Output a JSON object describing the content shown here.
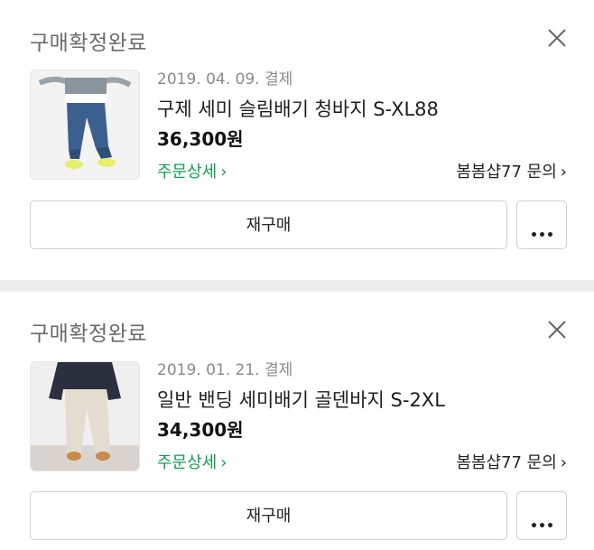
{
  "orders": [
    {
      "status": "구매확정완료",
      "date": "2019. 04. 09. 결제",
      "title": "구제 세미 슬림배기 청바지 S-XL88",
      "price": "36,300원",
      "detail_link": "주문상세",
      "seller_link": "봄봄샵77 문의",
      "rebuy_label": "재구매",
      "thumbnail_icon": "jeans-product-photo"
    },
    {
      "status": "구매확정완료",
      "date": "2019. 01. 21. 결제",
      "title": "일반 밴딩 세미배기 골덴바지 S-2XL",
      "price": "34,300원",
      "detail_link": "주문상세",
      "seller_link": "봄봄샵77 문의",
      "rebuy_label": "재구매",
      "thumbnail_icon": "corduroy-pants-product-photo"
    }
  ],
  "colors": {
    "accent_green": "#0f9d4f",
    "divider": "#ededed"
  }
}
